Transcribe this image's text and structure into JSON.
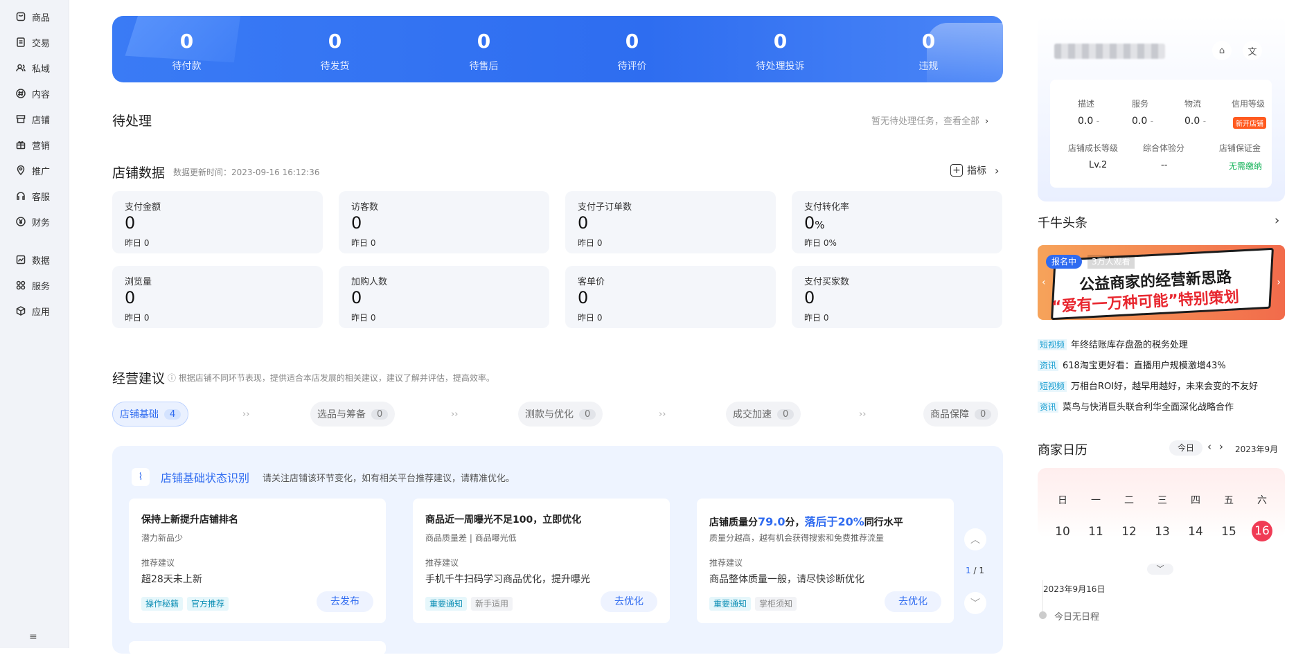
{
  "sidebar": {
    "items": [
      {
        "label": "商品",
        "icon": "bag-icon"
      },
      {
        "label": "交易",
        "icon": "receipt-icon"
      },
      {
        "label": "私域",
        "icon": "users-icon"
      },
      {
        "label": "内容",
        "icon": "hash-icon"
      },
      {
        "label": "店铺",
        "icon": "store-icon"
      },
      {
        "label": "营销",
        "icon": "gift-icon"
      },
      {
        "label": "推广",
        "icon": "pin-icon"
      },
      {
        "label": "客服",
        "icon": "headset-icon"
      },
      {
        "label": "财务",
        "icon": "yen-icon"
      },
      {
        "label": "数据",
        "icon": "chart-icon"
      },
      {
        "label": "服务",
        "icon": "grid-icon"
      },
      {
        "label": "应用",
        "icon": "cube-icon"
      }
    ],
    "collapse": "≡"
  },
  "banner": {
    "stats": [
      {
        "value": "0",
        "label": "待付款"
      },
      {
        "value": "0",
        "label": "待发货"
      },
      {
        "value": "0",
        "label": "待售后"
      },
      {
        "value": "0",
        "label": "待评价"
      },
      {
        "value": "0",
        "label": "待处理投诉"
      },
      {
        "value": "0",
        "label": "违规"
      }
    ]
  },
  "pending": {
    "title": "待处理",
    "link": "暂无待处理任务，查看全部"
  },
  "store_data": {
    "title": "店铺数据",
    "update_time": "数据更新时间：2023-09-16 16:12:36",
    "metrics_button": "指标",
    "cards": [
      {
        "title": "支付金额",
        "value": "0",
        "unit": "",
        "yesterday": "昨日 0"
      },
      {
        "title": "访客数",
        "value": "0",
        "unit": "",
        "yesterday": "昨日 0"
      },
      {
        "title": "支付子订单数",
        "value": "0",
        "unit": "",
        "yesterday": "昨日 0"
      },
      {
        "title": "支付转化率",
        "value": "0",
        "unit": "%",
        "yesterday": "昨日 0%"
      },
      {
        "title": "浏览量",
        "value": "0",
        "unit": "",
        "yesterday": "昨日 0"
      },
      {
        "title": "加购人数",
        "value": "0",
        "unit": "",
        "yesterday": "昨日 0"
      },
      {
        "title": "客单价",
        "value": "0",
        "unit": "",
        "yesterday": "昨日 0"
      },
      {
        "title": "支付买家数",
        "value": "0",
        "unit": "",
        "yesterday": "昨日 0"
      }
    ]
  },
  "advice": {
    "title": "经营建议",
    "desc": "ⓘ 根据店铺不同环节表现，提供适合本店发展的相关建议，建议了解并评估，提高效率。",
    "steps": [
      {
        "label": "店铺基础",
        "count": "4"
      },
      {
        "label": "选品与筹备",
        "count": "0"
      },
      {
        "label": "测款与优化",
        "count": "0"
      },
      {
        "label": "成交加速",
        "count": "0"
      },
      {
        "label": "商品保障",
        "count": "0"
      }
    ],
    "panel_title": "店铺基础状态识别",
    "panel_desc": "请关注店铺该环节变化，如有相关平台推荐建议，请精准优化。",
    "suggest_label": "推荐建议",
    "cards": [
      {
        "h": "保持上新提升店铺排名",
        "sub": "潜力新品少",
        "rv": "超28天未上新",
        "tags": [
          "操作秘籍",
          "官方推荐"
        ],
        "btn": "去发布"
      },
      {
        "h": "商品近一周曝光不足100，立即优化",
        "sub": "商品质量差 | 商品曝光低",
        "rv": "手机千牛扫码学习商品优化，提升曝光",
        "tags": [
          "重要通知",
          "新手适用"
        ],
        "btn": "去优化"
      },
      {
        "h1": "店铺质量分",
        "score": "79.0",
        "h2": "分，",
        "behind": "落后于20%",
        "h3": "同行水平",
        "sub": "质量分越高，越有机会获得搜索和免费推荐流量",
        "rv": "商品整体质量一般，请尽快诊断优化",
        "tags": [
          "重要通知",
          "掌柜须知"
        ],
        "btn": "去优化"
      }
    ],
    "pager_cur": "1",
    "pager_total": "/ 1"
  },
  "shop_panel": {
    "labels": [
      "描述",
      "服务",
      "物流",
      "信用等级"
    ],
    "values": [
      "0.0",
      "0.0",
      "0.0"
    ],
    "dash": "-",
    "credit_badge": "新开店铺",
    "labels2": [
      "店铺成长等级",
      "综合体验分",
      "店铺保证金"
    ],
    "level": "Lv.2",
    "exp": "--",
    "deposit": "无需缴纳"
  },
  "headlines": {
    "title": "千牛头条",
    "banner_tag": "报名中",
    "banner_viewers": "3万人观看",
    "banner_line1": "公益商家的经营新思路",
    "banner_line2": "“爱有一万种可能”特别策划",
    "news": [
      {
        "tag": "短视频",
        "text": "年终结账库存盘盈的税务处理"
      },
      {
        "tag": "资讯",
        "text": "618淘宝更好看：直播用户规模激增43%"
      },
      {
        "tag": "短视频",
        "text": "万相台ROI好，越早用越好，未来会变的不友好"
      },
      {
        "tag": "资讯",
        "text": "菜鸟与快消巨头联合利华全面深化战略合作"
      }
    ]
  },
  "calendar": {
    "title": "商家日历",
    "today_btn": "今日",
    "month": "2023年9月",
    "weekdays": [
      "日",
      "一",
      "二",
      "三",
      "四",
      "五",
      "六"
    ],
    "days": [
      "10",
      "11",
      "12",
      "13",
      "14",
      "15",
      "16"
    ],
    "selected_date": "2023年9月16日",
    "empty": "今日无日程"
  },
  "colors": {
    "primary": "#2f6bf0",
    "banner": "#3a7bf5",
    "today": "#f03b55"
  }
}
